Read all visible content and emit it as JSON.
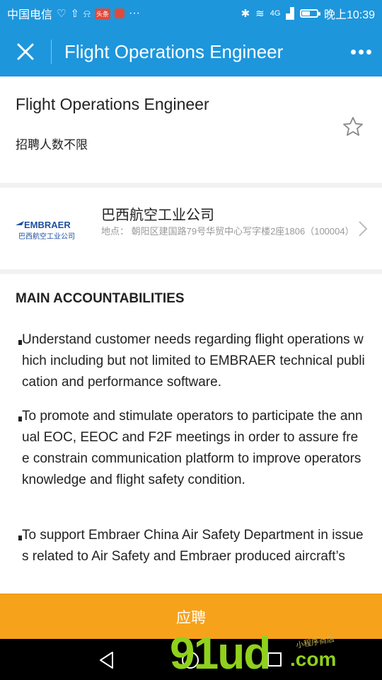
{
  "status_bar": {
    "carrier": "中国电信",
    "badge": "头条",
    "dots": "···",
    "network": "4G",
    "time": "晚上10:39",
    "battery_level": 0.55
  },
  "app_bar": {
    "title": "Flight Operations Engineer"
  },
  "job": {
    "title": "Flight Operations Engineer",
    "headcount": "招聘人数不限"
  },
  "company": {
    "logo_text": "EMBRAER",
    "logo_sub": "巴西航空工业公司",
    "name": "巴西航空工业公司",
    "address": "地点：  朝阳区建国路79号华贸中心写字楼2座1806（100004）"
  },
  "description": {
    "heading": "MAIN ACCOUNTABILITIES",
    "items": [
      "Understand customer needs regarding flight operations which including but not limited to EMBRAER technical publication and performance software.",
      "To promote and stimulate operators to participate the annual EOC, EEOC and F2F meetings in order to assure free constrain communication platform to improve operators knowledge and flight safety condition.",
      "To support Embraer China Air Safety Department in issues related to Air Safety and Embraer produced aircraft’s"
    ]
  },
  "apply_label": "应聘",
  "watermark": {
    "text": "91ud",
    "suffix": ".com",
    "tagline": "小程序商店"
  },
  "colors": {
    "accent": "#1e96dc",
    "apply": "#f7a21b",
    "watermark": "#8fd11c"
  }
}
